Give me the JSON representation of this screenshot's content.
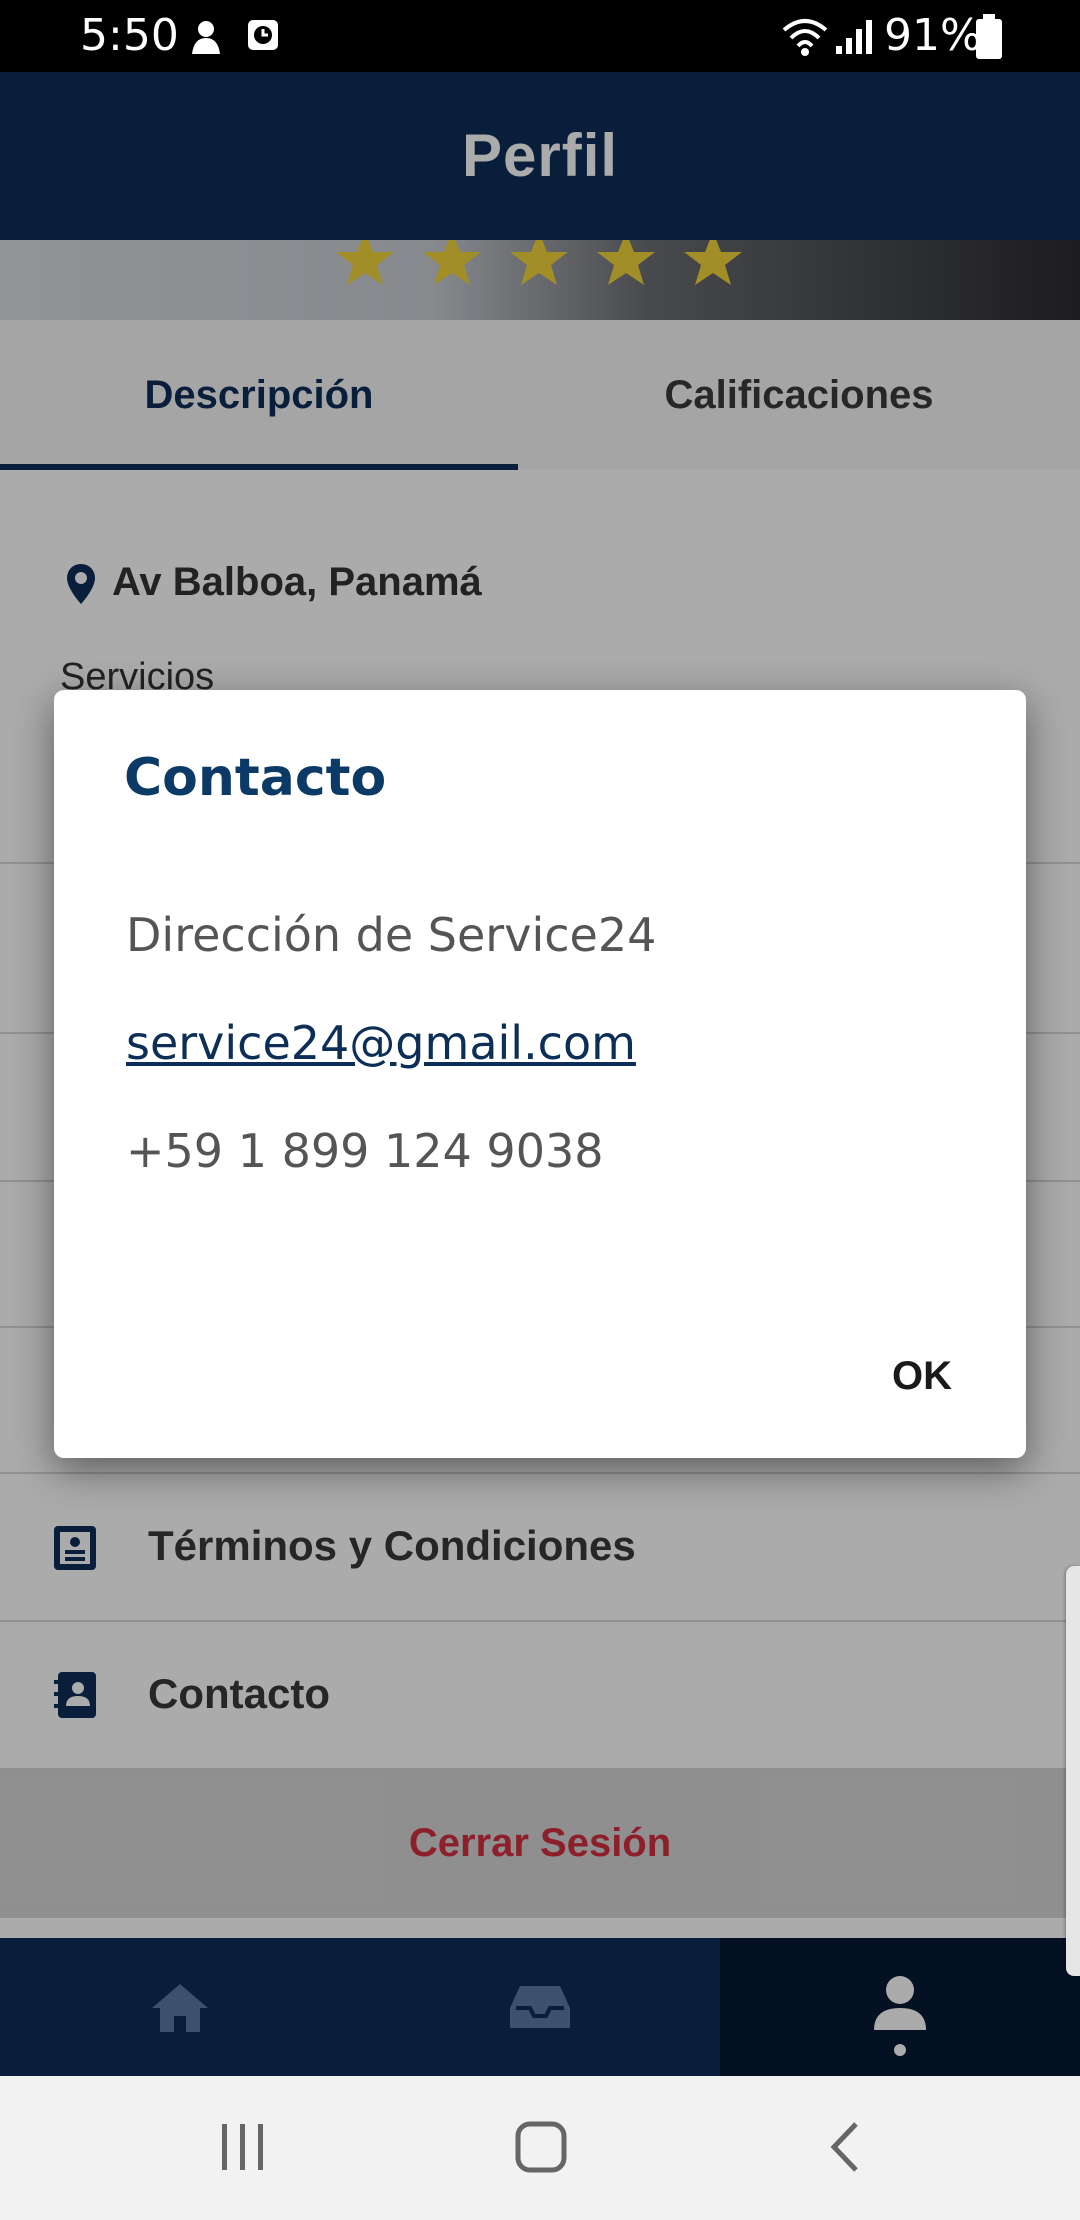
{
  "status_bar": {
    "time": "5:50",
    "battery": "91%"
  },
  "header": {
    "title": "Perfil"
  },
  "banner": {
    "rating_stars": 5
  },
  "tabs": [
    {
      "label": "Descripción"
    },
    {
      "label": "Calificaciones"
    }
  ],
  "profile": {
    "location": "Av Balboa, Panamá",
    "servicios_label": "Servicios"
  },
  "menu": [
    {
      "label": "Términos y Condiciones",
      "icon": "document-icon"
    },
    {
      "label": "Contacto",
      "icon": "contact-book-icon"
    }
  ],
  "logout_label": "Cerrar Sesión",
  "bottom_nav": [
    {
      "icon": "home-icon"
    },
    {
      "icon": "inbox-icon"
    },
    {
      "icon": "user-icon",
      "active": true
    }
  ],
  "dialog": {
    "title": "Contacto",
    "address": "Dirección de Service24",
    "email": "service24@gmail.com",
    "phone": "+59 1 899 124 9038",
    "ok_label": "OK"
  },
  "colors": {
    "primary": "#0c2e57",
    "logout": "#d32f3f",
    "star": "#f2d43a"
  }
}
